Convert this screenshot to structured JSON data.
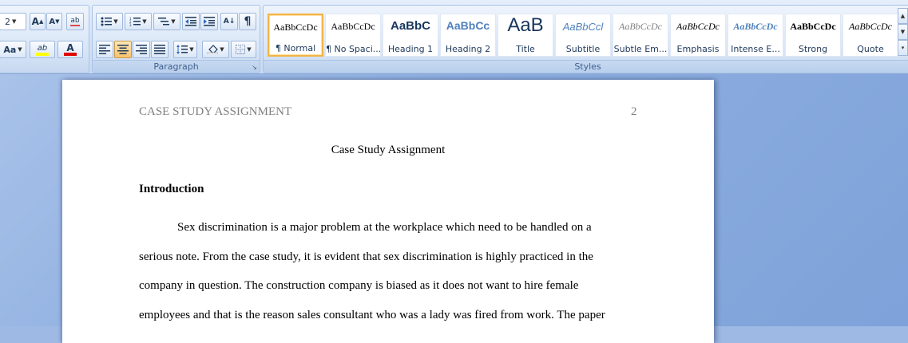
{
  "ribbon": {
    "font": {
      "size_value": "2",
      "grow_label": "A",
      "shrink_label": "A",
      "clear_label": "ab",
      "change_case_label": "Aa",
      "highlight_label": "ab",
      "font_color_label": "A",
      "highlight_color": "#ffff00",
      "font_color": "#e00000"
    },
    "paragraph": {
      "label": "Paragraph",
      "sort_label": "A↓",
      "pilcrow": "¶"
    },
    "styles": {
      "label": "Styles",
      "items": [
        {
          "preview": "AaBbCcDc",
          "name": "¶ Normal",
          "color": "#000000"
        },
        {
          "preview": "AaBbCcDc",
          "name": "¶ No Spaci...",
          "color": "#000000"
        },
        {
          "preview": "AaBbC",
          "name": "Heading 1",
          "color": "#17365d"
        },
        {
          "preview": "AaBbCc",
          "name": "Heading 2",
          "color": "#4f81bd"
        },
        {
          "preview": "AaB",
          "name": "Title",
          "color": "#17365d"
        },
        {
          "preview": "AaBbCcl",
          "name": "Subtitle",
          "color": "#4f81bd"
        },
        {
          "preview": "AaBbCcDc",
          "name": "Subtle Em...",
          "color": "#808080"
        },
        {
          "preview": "AaBbCcDc",
          "name": "Emphasis",
          "color": "#000000"
        },
        {
          "preview": "AaBbCcDc",
          "name": "Intense E...",
          "color": "#4f81bd"
        },
        {
          "preview": "AaBbCcDc",
          "name": "Strong",
          "color": "#000000"
        },
        {
          "preview": "AaBbCcDc",
          "name": "Quote",
          "color": "#000000"
        }
      ]
    }
  },
  "document": {
    "header_left": "CASE STUDY ASSIGNMENT",
    "header_page": "2",
    "title": "Case Study Assignment",
    "heading": "Introduction",
    "lines": [
      "Sex discrimination is a major problem at the workplace which need to be handled on a",
      "serious note. From the case study, it is evident that sex discrimination is highly practiced in the",
      "company in question. The construction company is biased as it does not want to hire female",
      "employees and that is the reason sales consultant who was a lady was fired from work. The paper"
    ]
  }
}
